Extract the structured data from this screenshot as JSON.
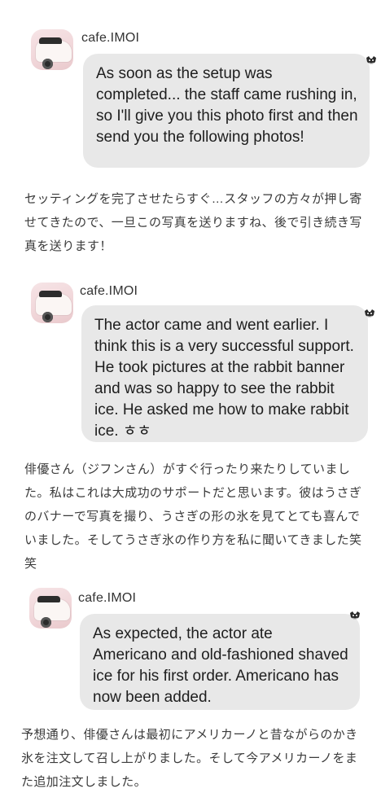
{
  "posts": [
    {
      "username": "cafe.IMOI",
      "message": "As soon as the setup was completed... the staff came rushing in, so I'll give you this photo first and then send you the following photos!",
      "badge_icon": "schnauzer-icon",
      "translation": "セッティングを完了させたらすぐ…スタッフの方々が押し寄せてきたので、一旦この写真を送りますね、後で引き続き写真を送ります！"
    },
    {
      "username": "cafe.IMOI",
      "message": "The actor came and went earlier. I think this is a very successful support. He took pictures at the rabbit banner and was so happy to see the rabbit ice. He asked me how to make rabbit ice. ㅎㅎ",
      "badge_icon": "schnauzer-icon",
      "translation": "俳優さん（ジフンさん）がすぐ行ったり来たりしていました。私はこれは大成功のサポートだと思います。彼はうさぎのバナーで写真を撮り、うさぎの形の氷を見てとても喜んでいました。そしてうさぎ氷の作り方を私に聞いてきました笑笑"
    },
    {
      "username": "cafe.IMOI",
      "message": "As expected, the actor ate Americano and old-fashioned shaved ice for his first order. Americano has now been added.",
      "badge_icon": "schnauzer-icon",
      "translation": "予想通り、俳優さんは最初にアメリカーノと昔ながらのかき氷を注文して召し上がりました。そして今アメリカーノをまた追加注文しました。"
    }
  ]
}
